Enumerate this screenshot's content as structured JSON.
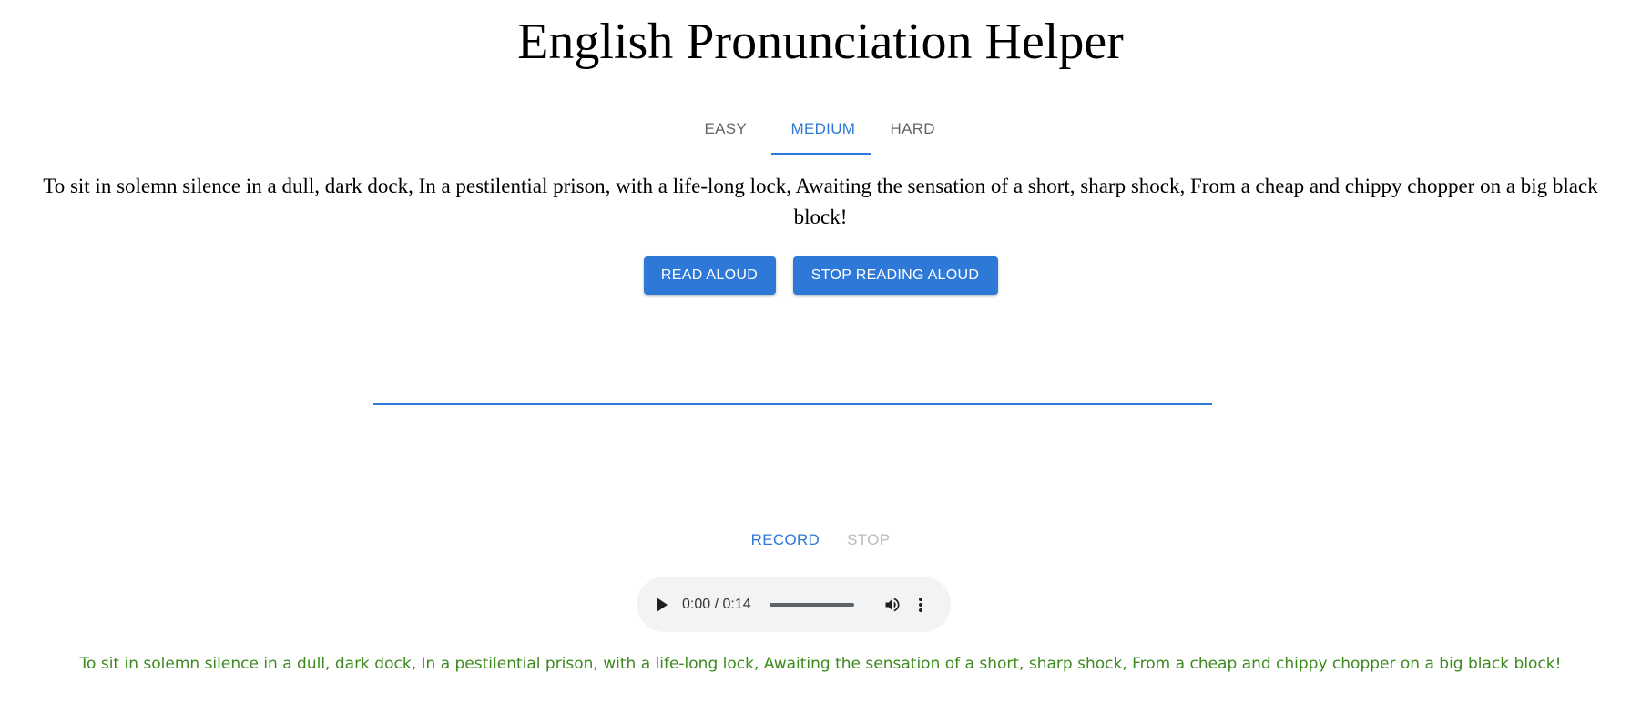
{
  "app": {
    "title": "English Pronunciation Helper"
  },
  "tabs": [
    {
      "label": "EASY",
      "active": false
    },
    {
      "label": "MEDIUM",
      "active": true
    },
    {
      "label": "HARD",
      "active": false
    }
  ],
  "passage": {
    "text": "To sit in solemn silence in a dull, dark dock, In a pestilential prison, with a life-long lock, Awaiting the sensation of a short, sharp shock, From a cheap and chippy chopper on a big black block!"
  },
  "read_controls": {
    "read_label": "READ ALOUD",
    "stop_label": "STOP READING ALOUD"
  },
  "record_controls": {
    "record_label": "RECORD",
    "stop_label": "STOP"
  },
  "audio_player": {
    "time_display": "0:00 / 0:14",
    "icons": [
      "play-icon",
      "volume-icon",
      "more-options-icon"
    ]
  },
  "transcript": {
    "text": "To sit in solemn silence in a dull, dark dock, In a pestilential prison, with a life-long lock, Awaiting the sensation of a short, sharp shock, From a cheap and chippy chopper on a big black block!"
  },
  "colors": {
    "accent": "#2e78d8",
    "transcript_green": "#3c8a1e",
    "disabled_gray": "#bbbbbb",
    "player_bg": "#f1f3f4"
  }
}
